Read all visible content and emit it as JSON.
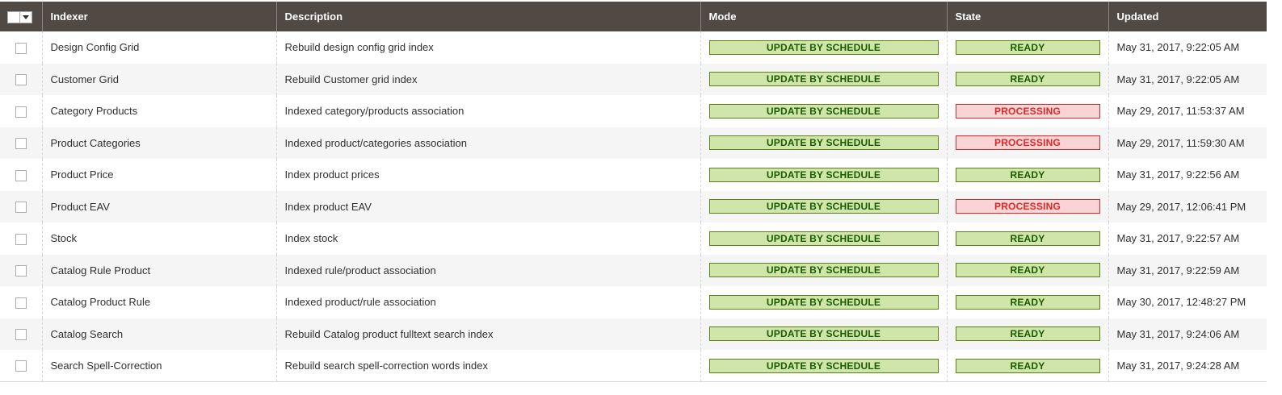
{
  "grid": {
    "columns": {
      "indexer": "Indexer",
      "description": "Description",
      "mode": "Mode",
      "state": "State",
      "updated": "Updated"
    },
    "rows": [
      {
        "indexer": "Design Config Grid",
        "description": "Rebuild design config grid index",
        "mode": "UPDATE BY SCHEDULE",
        "state": "READY",
        "state_status": "ok",
        "updated": "May 31, 2017, 9:22:05 AM"
      },
      {
        "indexer": "Customer Grid",
        "description": "Rebuild Customer grid index",
        "mode": "UPDATE BY SCHEDULE",
        "state": "READY",
        "state_status": "ok",
        "updated": "May 31, 2017, 9:22:05 AM"
      },
      {
        "indexer": "Category Products",
        "description": "Indexed category/products association",
        "mode": "UPDATE BY SCHEDULE",
        "state": "PROCESSING",
        "state_status": "bad",
        "updated": "May 29, 2017, 11:53:37 AM"
      },
      {
        "indexer": "Product Categories",
        "description": "Indexed product/categories association",
        "mode": "UPDATE BY SCHEDULE",
        "state": "PROCESSING",
        "state_status": "bad",
        "updated": "May 29, 2017, 11:59:30 AM"
      },
      {
        "indexer": "Product Price",
        "description": "Index product prices",
        "mode": "UPDATE BY SCHEDULE",
        "state": "READY",
        "state_status": "ok",
        "updated": "May 31, 2017, 9:22:56 AM"
      },
      {
        "indexer": "Product EAV",
        "description": "Index product EAV",
        "mode": "UPDATE BY SCHEDULE",
        "state": "PROCESSING",
        "state_status": "bad",
        "updated": "May 29, 2017, 12:06:41 PM"
      },
      {
        "indexer": "Stock",
        "description": "Index stock",
        "mode": "UPDATE BY SCHEDULE",
        "state": "READY",
        "state_status": "ok",
        "updated": "May 31, 2017, 9:22:57 AM"
      },
      {
        "indexer": "Catalog Rule Product",
        "description": "Indexed rule/product association",
        "mode": "UPDATE BY SCHEDULE",
        "state": "READY",
        "state_status": "ok",
        "updated": "May 31, 2017, 9:22:59 AM"
      },
      {
        "indexer": "Catalog Product Rule",
        "description": "Indexed product/rule association",
        "mode": "UPDATE BY SCHEDULE",
        "state": "READY",
        "state_status": "ok",
        "updated": "May 30, 2017, 12:48:27 PM"
      },
      {
        "indexer": "Catalog Search",
        "description": "Rebuild Catalog product fulltext search index",
        "mode": "UPDATE BY SCHEDULE",
        "state": "READY",
        "state_status": "ok",
        "updated": "May 31, 2017, 9:24:06 AM"
      },
      {
        "indexer": "Search Spell-Correction",
        "description": "Rebuild search spell-correction words index",
        "mode": "UPDATE BY SCHEDULE",
        "state": "READY",
        "state_status": "ok",
        "updated": "May 31, 2017, 9:24:28 AM"
      }
    ]
  },
  "colors": {
    "header_bg": "#514943",
    "ok_bg": "#d0e5a9",
    "ok_border": "#5b8116",
    "ok_text": "#185b00",
    "bad_bg": "#f9d4d4",
    "bad_border": "#e22626",
    "bad_text": "#e22626"
  },
  "icons": {
    "mass_select": "chevron-down-icon"
  }
}
